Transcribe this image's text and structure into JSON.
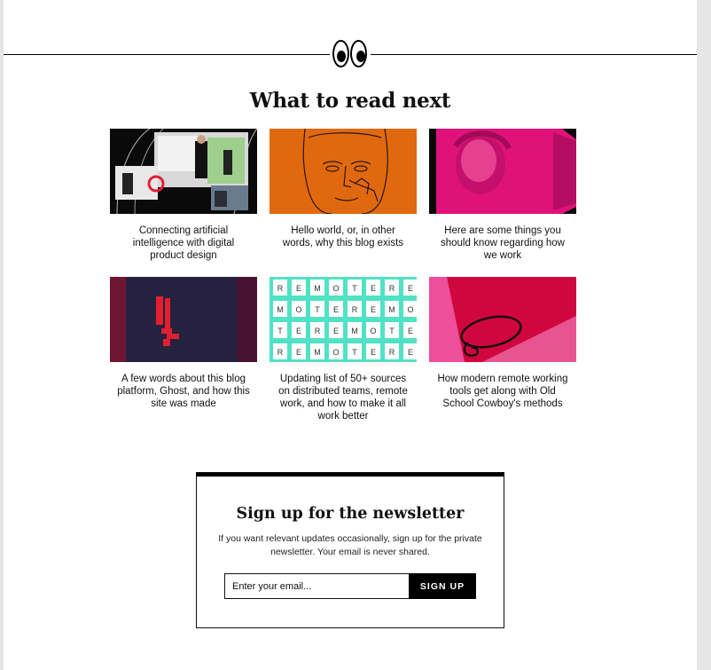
{
  "section": {
    "title": "What to read next",
    "icon": "googly-eyes-icon"
  },
  "posts": [
    {
      "title": "Connecting artificial intelligence with digital product design",
      "thumbnail": "conference-stage-photo"
    },
    {
      "title": "Hello world, or, in other words, why this blog exists",
      "thumbnail": "orange-face-sketch"
    },
    {
      "title": "Here are some things you should know regarding how we work",
      "thumbnail": "pink-portrait-screen"
    },
    {
      "title": "A few words about this blog platform, Ghost, and how this site was made",
      "thumbnail": "navy-exclamation-graphic"
    },
    {
      "title": "Updating list of 50+ sources on distributed teams, remote work, and how to make it all work better",
      "thumbnail": "remote-letter-tiles"
    },
    {
      "title": "How modern remote working tools get along with Old School Cowboy's methods",
      "thumbnail": "pink-lasso-graphic"
    }
  ],
  "remote_tiles": [
    [
      "R",
      "E",
      "M",
      "O",
      "T",
      "E",
      "R",
      "E"
    ],
    [
      "M",
      "O",
      "T",
      "E",
      "R",
      "E",
      "M",
      "O"
    ],
    [
      "T",
      "E",
      "R",
      "E",
      "M",
      "O",
      "T",
      "E"
    ],
    [
      "R",
      "E",
      "M",
      "O",
      "T",
      "E",
      "R",
      "E"
    ]
  ],
  "newsletter": {
    "title": "Sign up for the newsletter",
    "description": "If you want relevant updates occasionally, sign up for the private newsletter. Your email is never shared.",
    "email_placeholder": "Enter your email...",
    "button_label": "SIGN UP"
  }
}
